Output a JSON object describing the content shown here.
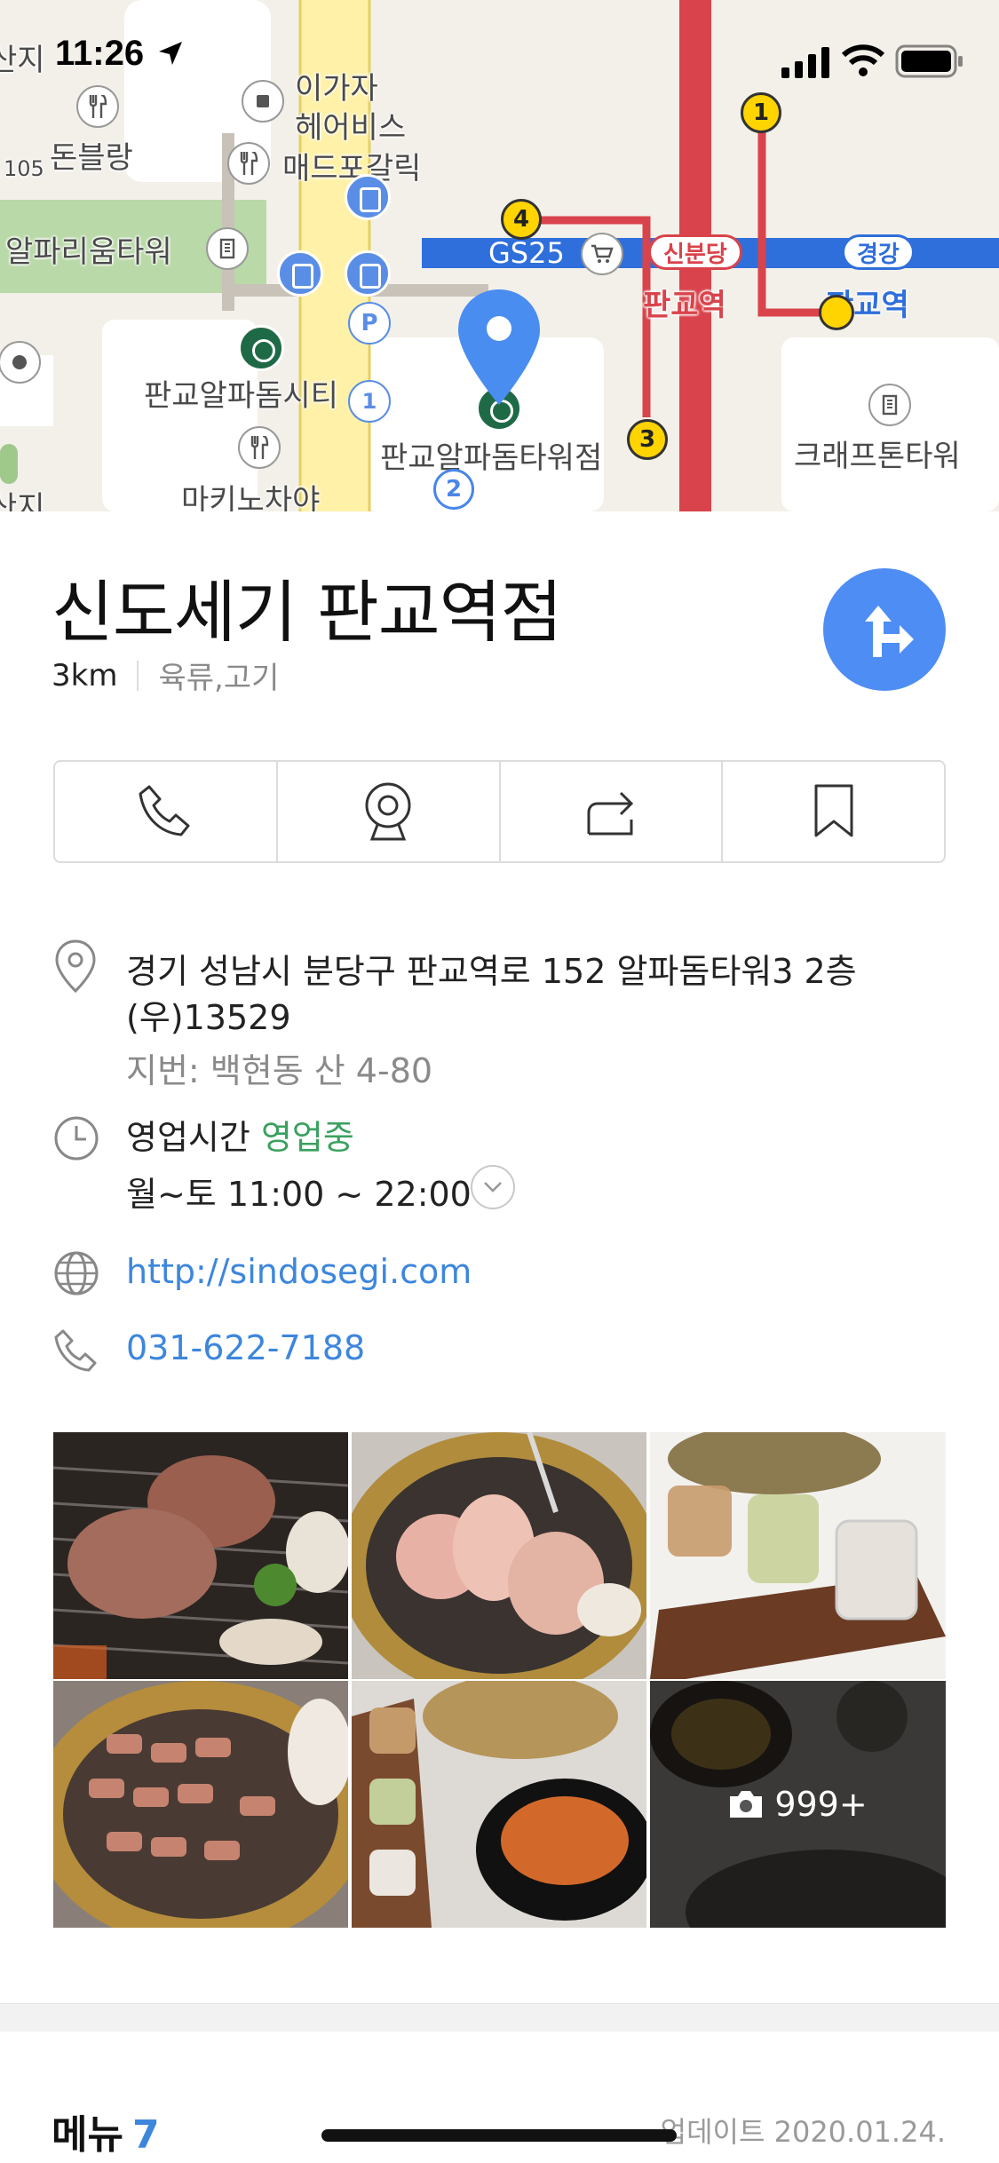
{
  "status_bar": {
    "time": "11:26"
  },
  "map": {
    "labels": {
      "top_left_partial": "산지",
      "donblang": "돈블랑",
      "n105": "105",
      "igaja": "이가자",
      "hair": "헤어비스",
      "maddpo": "매드포갈릭",
      "alpha_rium": "알파리움타워",
      "gs25": "GS25",
      "pangyo_station_red": "판교역",
      "pangyo_station_blue": "판교역",
      "alphadom_city": "판교알파돔시티",
      "alphadom_tower_store": "판교알파돔타워점",
      "crafton": "크래프톤타워",
      "makino": "마키노차야",
      "bottom_left_partial": "산지"
    },
    "station_tags": {
      "sinbundang": "신분당",
      "gyeonggang": "경강"
    },
    "exits": [
      "1",
      "4",
      "3",
      "2",
      "1"
    ],
    "colors": {
      "red_line": "#d9434b",
      "blue_line": "#2f6fdb",
      "road_yellow": "#fff2a8",
      "park_green": "#b9d9a8",
      "pin": "#4a8df0"
    }
  },
  "place": {
    "name": "신도세기 판교역점",
    "distance": "3km",
    "category": "육류,고기"
  },
  "actions": [
    {
      "icon": "phone-icon"
    },
    {
      "icon": "street-view-icon"
    },
    {
      "icon": "share-icon"
    },
    {
      "icon": "bookmark-icon"
    }
  ],
  "details": {
    "address_line1": "경기 성남시 분당구 판교역로 152 알파돔타워3 2층",
    "address_line2": "(우)13529",
    "lot_address": "지번: 백현동 산 4-80",
    "hours_label": "영업시간",
    "hours_status": "영업중",
    "hours": "월~토 11:00 ~ 22:00",
    "website": "http://sindosegi.com",
    "phone": "031-622-7188"
  },
  "photos": {
    "more_count": "999+"
  },
  "menu": {
    "title": "메뉴",
    "count": "7",
    "updated": "업데이트 2020.01.24."
  }
}
